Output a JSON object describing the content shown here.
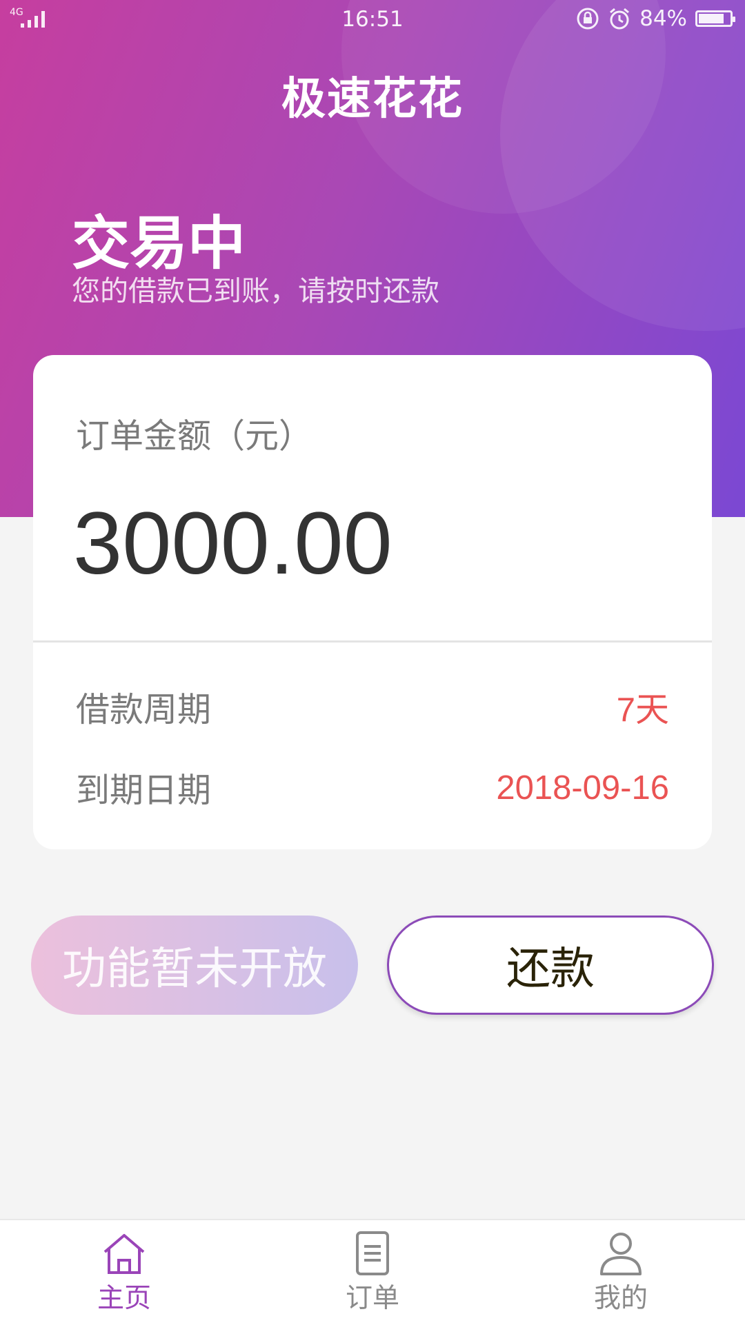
{
  "status_bar": {
    "network": "4G",
    "time": "16:51",
    "battery_text": "84%",
    "battery_level": 0.84,
    "icons": [
      "signal-icon",
      "rotation-lock-icon",
      "alarm-icon",
      "battery-icon"
    ]
  },
  "header": {
    "app_title": "极速花花",
    "state_title": "交易中",
    "state_subtitle": "您的借款已到账，请按时还款"
  },
  "card": {
    "amount_label": "订单金额（元）",
    "amount": "3000.00",
    "rows": [
      {
        "label": "借款周期",
        "value": "7天"
      },
      {
        "label": "到期日期",
        "value": "2018-09-16"
      }
    ]
  },
  "actions": {
    "disabled_label": "功能暂未开放",
    "repay_label": "还款"
  },
  "tabbar": {
    "items": [
      {
        "label": "主页",
        "icon": "home-icon",
        "active": true
      },
      {
        "label": "订单",
        "icon": "document-icon",
        "active": false
      },
      {
        "label": "我的",
        "icon": "person-icon",
        "active": false
      }
    ]
  },
  "colors": {
    "accent": "#9a44b8",
    "value_red": "#ea5353",
    "gradient_start": "#c63e9f",
    "gradient_end": "#7b48d3"
  }
}
